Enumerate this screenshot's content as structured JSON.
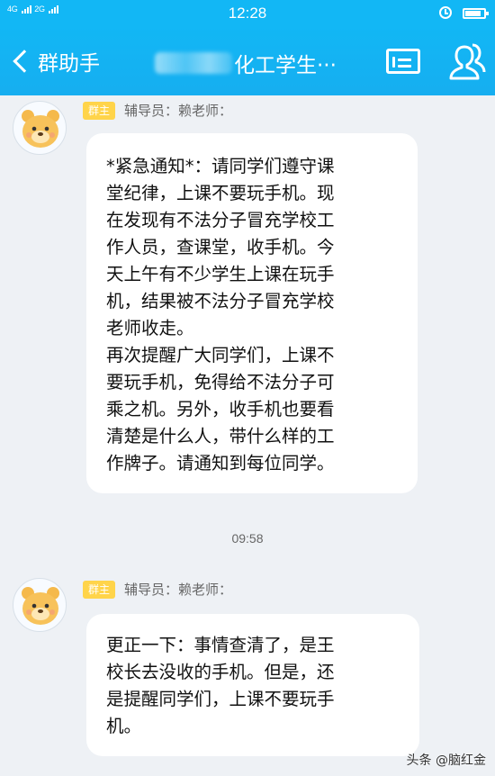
{
  "status_bar": {
    "network": "4G",
    "network2": "2G",
    "time": "12:28",
    "battery_level": 0.85
  },
  "header": {
    "back_label": "群助手",
    "title_suffix": "化工学生···"
  },
  "messages": [
    {
      "badge": "群主",
      "sender": "辅导员：赖老师：",
      "paragraphs": [
        "*紧急通知*：请同学们遵守课\n堂纪律，上课不要玩手机。现\n在发现有不法分子冒充学校工\n作人员，查课堂，收手机。今\n天上午有不少学生上课在玩手\n机，结果被不法分子冒充学校\n老师收走。",
        "再次提醒广大同学们，上课不\n要玩手机，免得给不法分子可\n乘之机。另外，收手机也要看\n清楚是什么人，带什么样的工\n作牌子。请通知到每位同学。"
      ]
    },
    {
      "badge": "群主",
      "sender": "辅导员：赖老师：",
      "paragraphs": [
        "更正一下：事情查清了，是王\n校长去没收的手机。但是，还\n是提醒同学们，上课不要玩手\n机。"
      ]
    }
  ],
  "time_divider": "09:58",
  "watermark": "头条 @脑红金",
  "colors": {
    "header_bg": "#12b7f5",
    "badge_bg": "#ffd44a",
    "chat_bg": "#eef1f5"
  }
}
